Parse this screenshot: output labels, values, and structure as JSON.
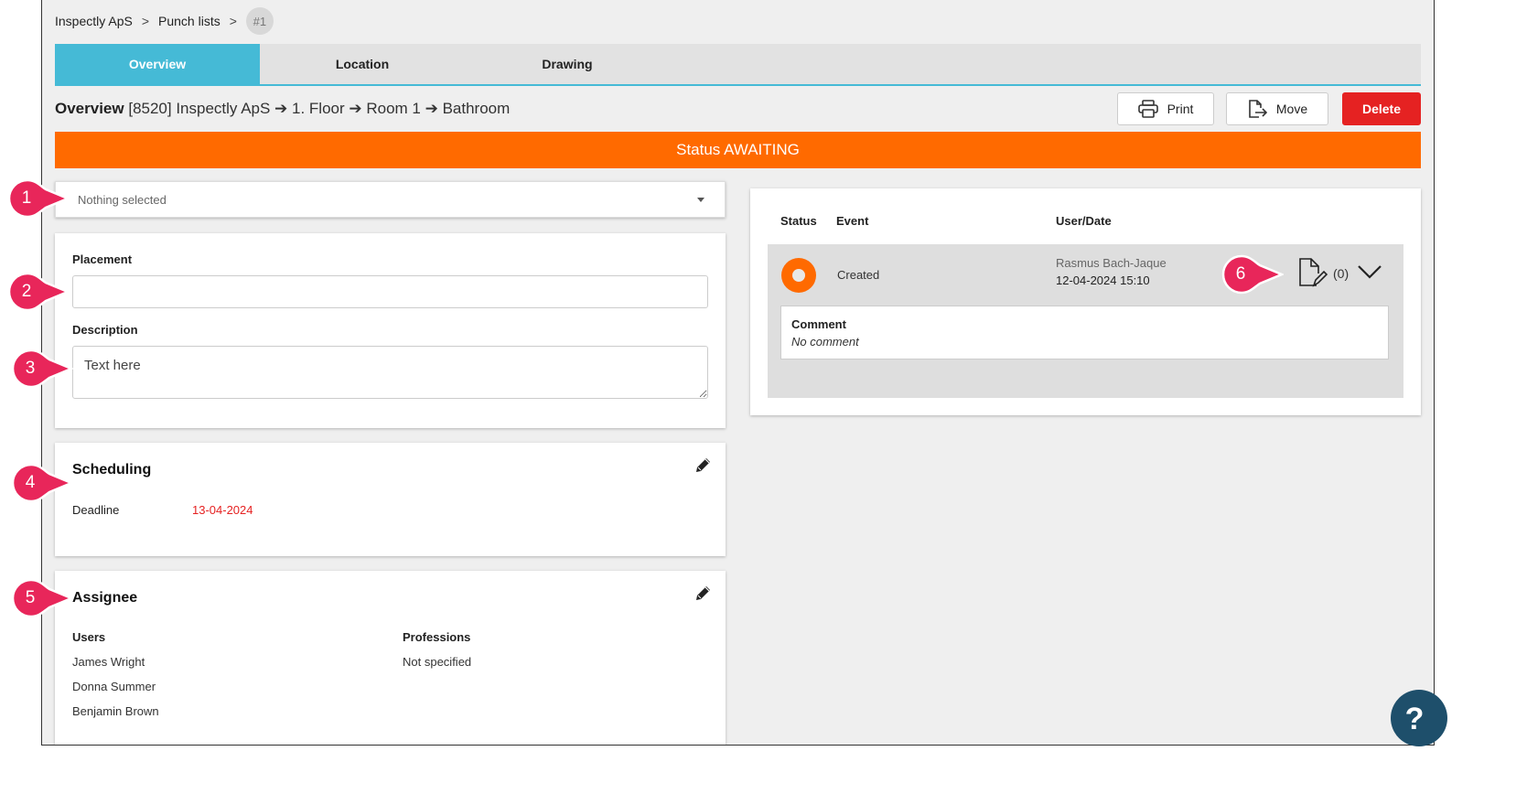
{
  "breadcrumb": {
    "items": [
      "Inspectly ApS",
      "Punch lists"
    ],
    "current": "#1"
  },
  "tabs": [
    {
      "label": "Overview",
      "active": true
    },
    {
      "label": "Location",
      "active": false
    },
    {
      "label": "Drawing",
      "active": false
    }
  ],
  "header": {
    "title_bold": "Overview",
    "title_path": "[8520] Inspectly ApS ➔ 1. Floor ➔ Room 1 ➔ Bathroom"
  },
  "toolbar": {
    "print_label": "Print",
    "move_label": "Move",
    "delete_label": "Delete"
  },
  "status": {
    "text": "Status AWAITING",
    "color": "#ff6a00"
  },
  "select": {
    "value": "Nothing selected"
  },
  "form": {
    "placement_label": "Placement",
    "placement_value": "",
    "description_label": "Description",
    "description_placeholder": "Text here"
  },
  "scheduling": {
    "title": "Scheduling",
    "deadline_label": "Deadline",
    "deadline_value": "13-04-2024",
    "deadline_color": "#e52222"
  },
  "assignee": {
    "title": "Assignee",
    "users_label": "Users",
    "users": [
      "James Wright",
      "Donna Summer",
      "Benjamin Brown"
    ],
    "professions_label": "Professions",
    "professions_value": "Not specified"
  },
  "history": {
    "col_status": "Status",
    "col_event": "Event",
    "col_user_date": "User/Date",
    "event": {
      "name": "Created",
      "user": "Rasmus Bach-Jaque",
      "date": "12-04-2024 15:10",
      "attachments_count": "(0)",
      "comment_label": "Comment",
      "comment_value": "No comment"
    }
  },
  "markers": [
    "1",
    "2",
    "3",
    "4",
    "5",
    "6"
  ],
  "help": {
    "label": "?"
  },
  "colors": {
    "accent": "#45bad6",
    "status": "#ff6a00",
    "danger": "#e52222",
    "marker": "#e8265a"
  }
}
